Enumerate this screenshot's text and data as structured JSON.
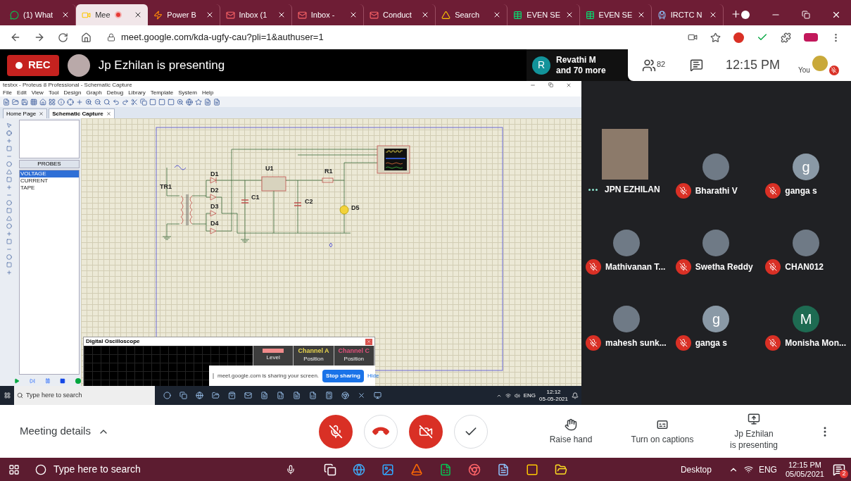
{
  "browser": {
    "tabs": [
      {
        "label": "(1) What",
        "selected": false,
        "recording": false
      },
      {
        "label": "Mee",
        "selected": true,
        "recording": true
      },
      {
        "label": "Power B",
        "selected": false,
        "recording": false
      },
      {
        "label": "Inbox (1",
        "selected": false,
        "recording": false
      },
      {
        "label": "Inbox - ",
        "selected": false,
        "recording": false
      },
      {
        "label": "Conduct",
        "selected": false,
        "recording": false
      },
      {
        "label": "Search",
        "selected": false,
        "recording": false
      },
      {
        "label": "EVEN SE",
        "selected": false,
        "recording": false
      },
      {
        "label": "EVEN SE",
        "selected": false,
        "recording": false
      },
      {
        "label": "IRCTC N",
        "selected": false,
        "recording": false
      }
    ],
    "url": "meet.google.com/kda-ugfy-cau?pli=1&authuser=1"
  },
  "meet_header": {
    "rec": "REC",
    "presenter": "Jp Ezhilan is presenting",
    "speaker": {
      "initial": "R",
      "name": "Revathi M",
      "more": "and 70 more"
    },
    "people_count": "82",
    "time": "12:15 PM",
    "self_label": "You"
  },
  "shared_screen": {
    "window_title": "testxx - Proteus 8 Professional - Schematic Capture",
    "menu": [
      "File",
      "Edit",
      "View",
      "Tool",
      "Design",
      "Graph",
      "Debug",
      "Library",
      "Template",
      "System",
      "Help"
    ],
    "tabs": [
      {
        "label": "Home Page",
        "selected": false
      },
      {
        "label": "Schematic Capture",
        "selected": true
      }
    ],
    "panel": {
      "title": "PROBES",
      "items": [
        {
          "label": "VOLTAGE",
          "selected": true
        },
        {
          "label": "CURRENT",
          "selected": false
        },
        {
          "label": "TAPE",
          "selected": false
        }
      ]
    },
    "schematic_labels": [
      {
        "text": "TR1",
        "kind": "part"
      },
      {
        "text": "D1",
        "kind": "part"
      },
      {
        "text": "D2",
        "kind": "part"
      },
      {
        "text": "D3",
        "kind": "part"
      },
      {
        "text": "D4",
        "kind": "part"
      },
      {
        "text": "U1",
        "kind": "part"
      },
      {
        "text": "C1",
        "kind": "part"
      },
      {
        "text": "C2",
        "kind": "part"
      },
      {
        "text": "R1",
        "kind": "part"
      },
      {
        "text": "D5",
        "kind": "part"
      }
    ],
    "oscilloscope": {
      "title": "Digital Oscilloscope",
      "channels": [
        {
          "sub": "Level",
          "color": "#f08a8a"
        },
        {
          "label": "Channel A",
          "sub": "Position",
          "color": "#e8d44d"
        },
        {
          "label": "Channel C",
          "sub": "Position",
          "color": "#e0507a"
        }
      ]
    },
    "share_banner": {
      "message": "meet.google.com is sharing your screen.",
      "stop": "Stop sharing",
      "hide": "Hide"
    },
    "taskbar": {
      "search": "Type here to search",
      "lang": "ENG",
      "time": "12:12",
      "date": "05-05-2021"
    }
  },
  "participants": [
    {
      "name": "JPN EZHILAN",
      "kind": "video",
      "muted": false
    },
    {
      "name": "Bharathi V",
      "kind": "photo",
      "muted": true
    },
    {
      "name": "ganga s",
      "kind": "letter",
      "letter": "g",
      "color": "#8a99a6",
      "muted": true
    },
    {
      "name": "Mathivanan T...",
      "kind": "photo",
      "muted": true
    },
    {
      "name": "Swetha Reddy",
      "kind": "photo",
      "muted": true
    },
    {
      "name": "CHAN012",
      "kind": "photo",
      "muted": true
    },
    {
      "name": "mahesh sunk...",
      "kind": "photo",
      "muted": true
    },
    {
      "name": "ganga s",
      "kind": "letter",
      "letter": "g",
      "color": "#8a99a6",
      "muted": true
    },
    {
      "name": "Monisha Mon...",
      "kind": "letter",
      "letter": "M",
      "color": "#1e6b52",
      "muted": true
    }
  ],
  "controls": {
    "meeting_details": "Meeting details",
    "buttons": [
      {
        "kind": "mic",
        "off": true
      },
      {
        "kind": "hangup",
        "off": false
      },
      {
        "kind": "camera",
        "off": true
      },
      {
        "kind": "check",
        "off": false
      }
    ],
    "actions": [
      {
        "kind": "hand",
        "lines": [
          "Raise hand"
        ]
      },
      {
        "kind": "captions",
        "lines": [
          "Turn on captions"
        ]
      },
      {
        "kind": "present",
        "lines": [
          "Jp Ezhilan",
          "is presenting"
        ]
      }
    ]
  },
  "taskbar": {
    "search": "Type here to search",
    "desktop": "Desktop",
    "lang": "ENG",
    "time": "12:15 PM",
    "date": "05/05/2021",
    "notifications": "2"
  }
}
